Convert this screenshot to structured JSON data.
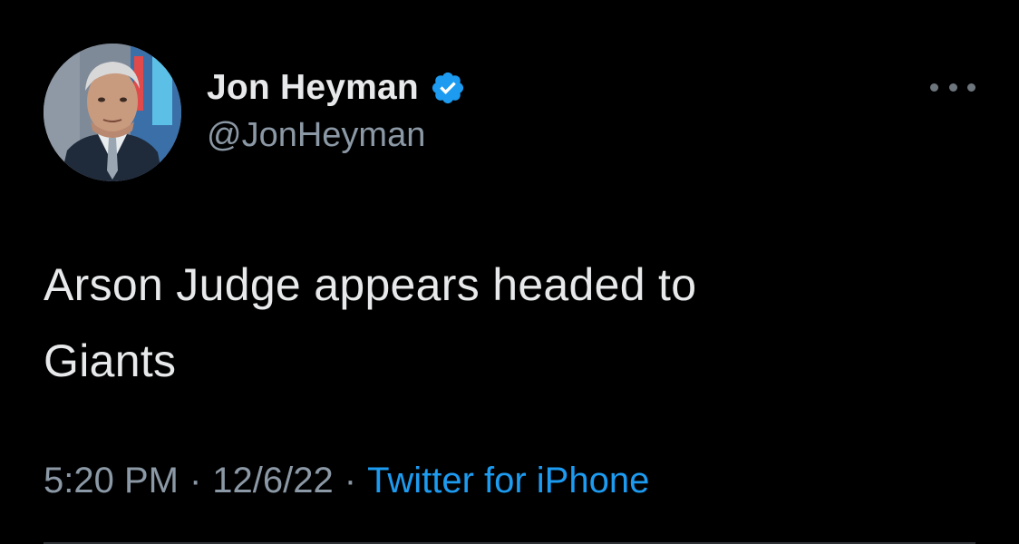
{
  "author": {
    "display_name": "Jon Heyman",
    "handle": "@JonHeyman",
    "verified": true,
    "avatar_icon": "profile-photo"
  },
  "tweet": {
    "text": "Arson Judge appears headed to\nGiants"
  },
  "meta": {
    "time": "5:20 PM",
    "date": "12/6/22",
    "separator": "·",
    "source": "Twitter for iPhone"
  },
  "menu": {
    "icon": "more-horizontal-icon"
  },
  "colors": {
    "background": "#000000",
    "primary_text": "#e7e9ea",
    "secondary_text": "#8b98a5",
    "accent": "#1d9bf0"
  }
}
